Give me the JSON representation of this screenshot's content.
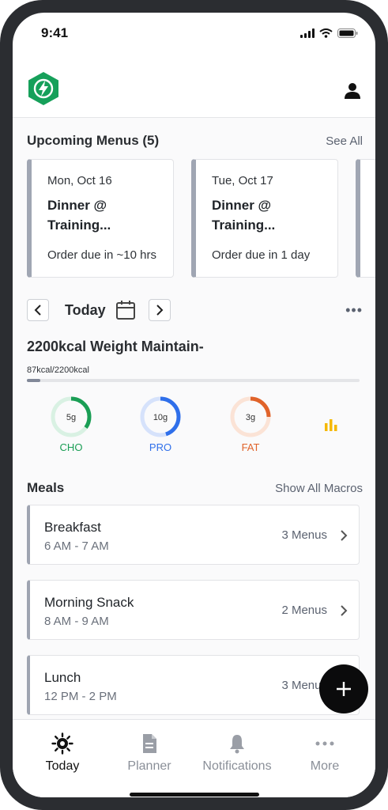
{
  "status_bar": {
    "time": "9:41"
  },
  "header": {
    "logo_icon": "lightning-hex-logo",
    "profile_icon": "user-icon"
  },
  "upcoming": {
    "title": "Upcoming Menus (5)",
    "see_all": "See All",
    "cards": [
      {
        "date": "Mon, Oct 16",
        "name": "Dinner @ Training...",
        "due": "Order due in ~10 hrs"
      },
      {
        "date": "Tue, Oct 17",
        "name": "Dinner @ Training...",
        "due": "Order due in 1 day"
      }
    ]
  },
  "date_nav": {
    "label": "Today"
  },
  "plan": {
    "title": "2200kcal Weight Maintain-",
    "kcal": "87kcal/2200kcal",
    "progress_fraction": 0.04
  },
  "macros": [
    {
      "value": "5g",
      "label": "CHO",
      "color": "#1a9e55",
      "track": "#d9f1e3",
      "fraction": 0.35
    },
    {
      "value": "10g",
      "label": "PRO",
      "color": "#2f6fea",
      "track": "#d6e2fb",
      "fraction": 0.45
    },
    {
      "value": "3g",
      "label": "FAT",
      "color": "#e0632a",
      "track": "#fbe3d6",
      "fraction": 0.25
    }
  ],
  "meals": {
    "title": "Meals",
    "show_all": "Show All Macros",
    "items": [
      {
        "name": "Breakfast",
        "time": "6 AM - 7 AM",
        "count": "3 Menus"
      },
      {
        "name": "Morning Snack",
        "time": "8 AM - 9 AM",
        "count": "2 Menus"
      },
      {
        "name": "Lunch",
        "time": "12 PM - 2 PM",
        "count": "3 Menus"
      }
    ]
  },
  "tabs": [
    {
      "label": "Today",
      "icon": "sun-icon",
      "active": true
    },
    {
      "label": "Planner",
      "icon": "document-icon",
      "active": false
    },
    {
      "label": "Notifications",
      "icon": "bell-icon",
      "active": false
    },
    {
      "label": "More",
      "icon": "more-dots-icon",
      "active": false
    }
  ],
  "colors": {
    "accent_green": "#16a05a",
    "fab": "#0b0b0c",
    "chart_icon": "#f5b800"
  }
}
